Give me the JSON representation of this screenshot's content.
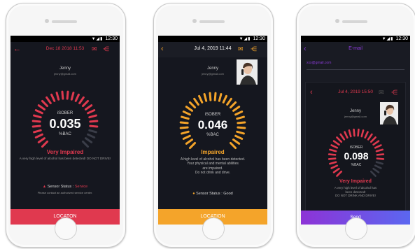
{
  "phones": [
    {
      "status_time": "12:30",
      "date": "Dec 18 2018 11:53",
      "user_name": "Jenny",
      "user_email": "jenny@gmail.com",
      "brand": "iSOBER",
      "value": "0.035",
      "unit": "%BAC",
      "impairment": "Very Impaired",
      "message": "A very high level of alcohol has been detected! DO NOT DRIVE!",
      "sensor_label": "Sensor Status :",
      "sensor_value": "Service",
      "sensor_note": "Please contact an authorized service center.",
      "button_label": "LOCATON",
      "gauge_level": 0.86
    },
    {
      "status_time": "12:30",
      "date": "Jul 4, 2019 11:44",
      "user_name": "Jenny",
      "user_email": "jenny@gmail.com",
      "brand": "iSOBER",
      "value": "0.046",
      "unit": "%BAC",
      "impairment": "Impaired",
      "message_lines": [
        "A high level of alcohol has been detected.",
        "Your physical and mental abilities",
        "are impaired.",
        "Do not drink and drive."
      ],
      "sensor_status": "Sensor Status : Good",
      "button_label": "LOCATION",
      "gauge_level": 1.0
    },
    {
      "status_time": "12:30",
      "title": "E-mail",
      "to_email": "xxx@gmail.com",
      "date": "Jul 4, 2019 15:50",
      "user_name": "Jenny",
      "user_email": "jenny@gmail.com",
      "brand": "iSOBER",
      "value": "0.098",
      "unit": "%BAC",
      "impairment": "Very Impaired",
      "message_lines": [
        "A very high level of alcohol has",
        "been detected!",
        "DO NOT DRINK AND DRIVE!"
      ],
      "button_label": "Send",
      "gauge_level": 0.86
    }
  ],
  "colors": {
    "red": "#e0394f",
    "orange": "#f4a42a",
    "purple": "#8a3bd6",
    "send_gradient_start": "#8d33d6",
    "send_gradient_end": "#5b67f0",
    "tick_off": "#3a3d48"
  }
}
